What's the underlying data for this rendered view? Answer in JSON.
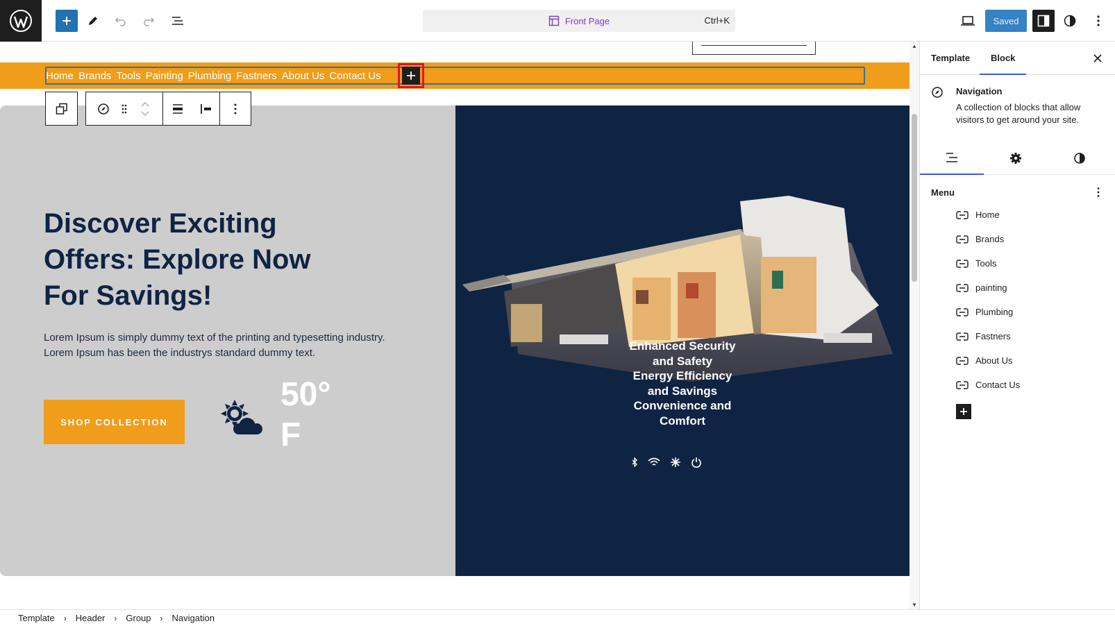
{
  "toolbar": {
    "command_title": "Front Page",
    "shortcut": "Ctrl+K",
    "saved_label": "Saved"
  },
  "nav": {
    "items": [
      "Home",
      "Brands",
      "Tools",
      "Painting",
      "Plumbing",
      "Fastners",
      "About Us",
      "Contact Us"
    ]
  },
  "hero": {
    "title": "Discover Exciting Offers: Explore Now For Savings!",
    "text_line1": "Lorem Ipsum is simply dummy text of the printing and typesetting industry.",
    "text_line2": "Lorem Ipsum has been the industrys standard dummy text.",
    "shop_button": "SHOP COLLECTION",
    "temperature": "50° F"
  },
  "features": [
    "Enhanced Security and Safety",
    "Energy Efficiency and Savings",
    "Convenience and Comfort"
  ],
  "breadcrumb": [
    "Template",
    "Header",
    "Group",
    "Navigation"
  ],
  "sidebar": {
    "tabs": [
      "Template",
      "Block"
    ],
    "block_name": "Navigation",
    "block_description": "A collection of blocks that allow visitors to get around your site.",
    "menu_label": "Menu",
    "menu_items": [
      "Home",
      "Brands",
      "Tools",
      "painting",
      "Plumbing",
      "Fastners",
      "About Us",
      "Contact Us"
    ]
  },
  "colors": {
    "accent_orange": "#f09d1b",
    "navy": "#0f2443",
    "wp_blue": "#2271b1",
    "selection_red": "#e3122a"
  }
}
